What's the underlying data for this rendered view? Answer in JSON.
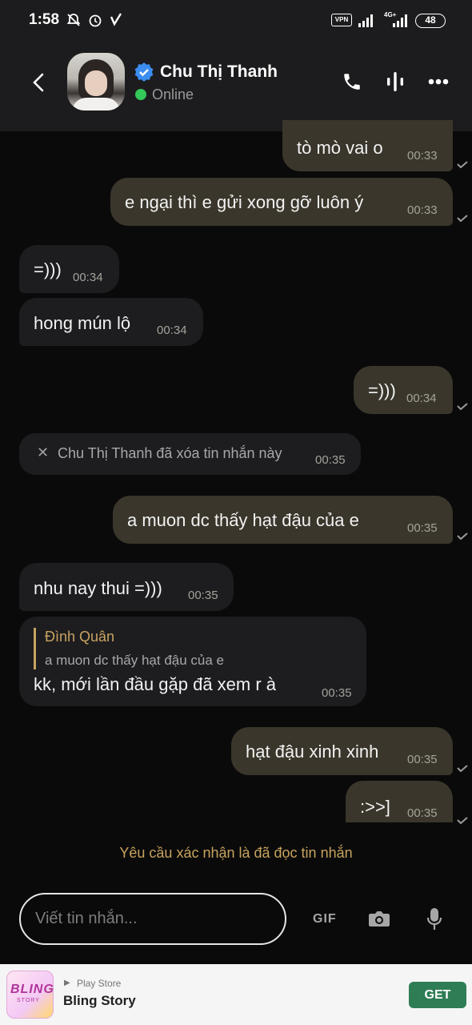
{
  "status_bar": {
    "time": "1:58",
    "vpn_label": "VPN",
    "network_label": "4G+",
    "battery": "48"
  },
  "header": {
    "contact_name": "Chu Thị Thanh",
    "status": "Online",
    "verified": true,
    "icons": [
      "back-arrow-icon",
      "phone-icon",
      "voice-icon",
      "more-icon"
    ]
  },
  "messages": [
    {
      "dir": "out",
      "text": "tò mò vai o",
      "time": "00:33",
      "read": true
    },
    {
      "dir": "out",
      "text": "e ngại thì e gửi xong gỡ luôn ý",
      "time": "00:33",
      "read": true
    },
    {
      "dir": "in",
      "text": "=)))",
      "time": "00:34"
    },
    {
      "dir": "in",
      "text": "hong mún lộ",
      "time": "00:34"
    },
    {
      "dir": "out",
      "text": "=)))",
      "time": "00:34",
      "read": true
    },
    {
      "dir": "out",
      "text": "a muon dc thấy hạt đậu của e",
      "time": "00:35",
      "read": true
    },
    {
      "dir": "in",
      "text": "nhu nay thui =)))",
      "time": "00:35"
    },
    {
      "dir": "out",
      "text": "hạt đậu xinh xinh",
      "time": "00:35",
      "read": true
    },
    {
      "dir": "out",
      "text": ":>>]",
      "time": "00:35",
      "read": true
    }
  ],
  "deleted_note": {
    "text": "Chu Thị Thanh đã xóa tin nhắn này",
    "time": "00:35"
  },
  "reply_message": {
    "quoted_author": "Đình Quân",
    "quoted_text": "a muon dc thấy hạt đậu của e",
    "text": "kk, mới lần đầu gặp đã xem r à",
    "time": "00:35"
  },
  "read_receipt_request": "Yêu cầu xác nhận là đã đọc tin nhắn",
  "composer": {
    "placeholder": "Viết tin nhắn...",
    "gif_label": "GIF"
  },
  "ad": {
    "logo_text": "BLING",
    "logo_sub": "STORY",
    "store": "Play Store",
    "title": "Bling Story",
    "cta": "GET"
  },
  "colors": {
    "background": "#0a0a0a",
    "header": "#1c1c1e",
    "outgoing_bubble": "#3a362b",
    "incoming_bubble": "#1d1d20",
    "accent": "#c7a35f",
    "online": "#34c759",
    "cta": "#2e7d54"
  }
}
